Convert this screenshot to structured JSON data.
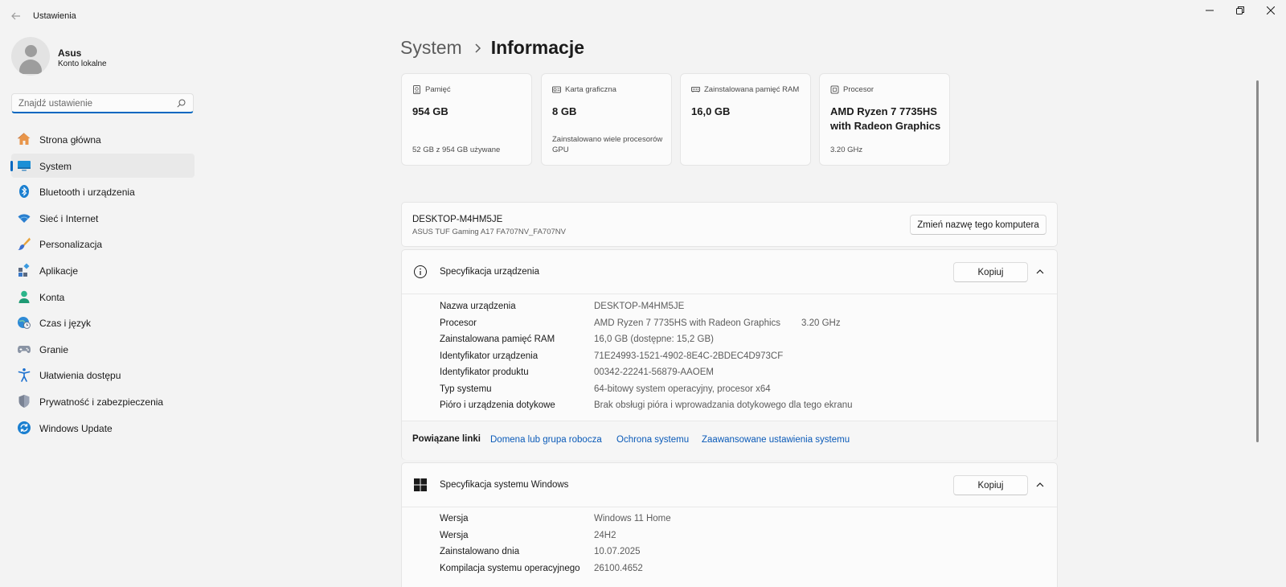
{
  "window": {
    "title": "Ustawienia",
    "back_icon": "back-arrow-icon",
    "controls": [
      "minimize-icon",
      "maximize-icon",
      "close-icon"
    ]
  },
  "account": {
    "name": "Asus",
    "type": "Konto lokalne"
  },
  "search": {
    "placeholder": "Znajdź ustawienie",
    "value": ""
  },
  "sidebar": {
    "items": [
      {
        "label": "Strona główna",
        "icon": "home-icon",
        "active": false
      },
      {
        "label": "System",
        "icon": "monitor-icon",
        "active": true
      },
      {
        "label": "Bluetooth i urządzenia",
        "icon": "bluetooth-icon",
        "active": false
      },
      {
        "label": "Sieć i Internet",
        "icon": "wifi-icon",
        "active": false
      },
      {
        "label": "Personalizacja",
        "icon": "brush-icon",
        "active": false
      },
      {
        "label": "Aplikacje",
        "icon": "apps-icon",
        "active": false
      },
      {
        "label": "Konta",
        "icon": "person-icon",
        "active": false
      },
      {
        "label": "Czas i język",
        "icon": "globe-clock-icon",
        "active": false
      },
      {
        "label": "Granie",
        "icon": "gamepad-icon",
        "active": false
      },
      {
        "label": "Ułatwienia dostępu",
        "icon": "accessibility-icon",
        "active": false
      },
      {
        "label": "Prywatność i zabezpieczenia",
        "icon": "shield-icon",
        "active": false
      },
      {
        "label": "Windows Update",
        "icon": "update-icon",
        "active": false
      }
    ]
  },
  "breadcrumb": {
    "parent": "System",
    "current": "Informacje"
  },
  "cards": [
    {
      "label": "Pamięć",
      "value": "954 GB",
      "sub": "52 GB z 954 GB używane",
      "icon": "storage-icon"
    },
    {
      "label": "Karta graficzna",
      "value": "8 GB",
      "sub": "Zainstalowano wiele procesorów GPU",
      "icon": "gpu-icon"
    },
    {
      "label": "Zainstalowana pamięć RAM",
      "value": "16,0 GB",
      "sub": "",
      "icon": "ram-icon"
    },
    {
      "label": "Procesor",
      "value": "AMD Ryzen 7 7735HS with Radeon Graphics",
      "sub": "3.20 GHz",
      "icon": "cpu-icon"
    }
  ],
  "pc": {
    "name": "DESKTOP-M4HM5JE",
    "model": "ASUS TUF Gaming A17 FA707NV_FA707NV",
    "rename_button": "Zmień nazwę tego komputera"
  },
  "device_spec": {
    "title": "Specyfikacja urządzenia",
    "copy_button": "Kopiuj",
    "icon": "info-icon",
    "rows": [
      {
        "key": "Nazwa urządzenia",
        "value": "DESKTOP-M4HM5JE",
        "extra": ""
      },
      {
        "key": "Procesor",
        "value": "AMD Ryzen 7 7735HS with Radeon Graphics",
        "extra": "3.20 GHz"
      },
      {
        "key": "Zainstalowana pamięć RAM",
        "value": "16,0 GB (dostępne: 15,2 GB)",
        "extra": ""
      },
      {
        "key": "Identyfikator urządzenia",
        "value": "71E24993-1521-4902-8E4C-2BDEC4D973CF",
        "extra": ""
      },
      {
        "key": "Identyfikator produktu",
        "value": "00342-22241-56879-AAOEM",
        "extra": ""
      },
      {
        "key": "Typ systemu",
        "value": "64-bitowy system operacyjny, procesor x64",
        "extra": ""
      },
      {
        "key": "Pióro i urządzenia dotykowe",
        "value": "Brak obsługi pióra i wprowadzania dotykowego dla tego ekranu",
        "extra": ""
      }
    ]
  },
  "related_links": {
    "label": "Powiązane linki",
    "links": [
      "Domena lub grupa robocza",
      "Ochrona systemu",
      "Zaawansowane ustawienia systemu"
    ]
  },
  "windows_spec": {
    "title": "Specyfikacja systemu Windows",
    "copy_button": "Kopiuj",
    "icon": "windows-logo-icon",
    "rows": [
      {
        "key": "Wersja",
        "value": "Windows 11 Home"
      },
      {
        "key": "Wersja",
        "value": "24H2"
      },
      {
        "key": "Zainstalowano dnia",
        "value": "10.07.2025"
      },
      {
        "key": "Kompilacja systemu operacyjnego",
        "value": "26100.4652"
      }
    ]
  },
  "colors": {
    "accent": "#0067c0",
    "link": "#0a5ab8",
    "background": "#f3f3f3",
    "card": "#fbfbfb"
  }
}
